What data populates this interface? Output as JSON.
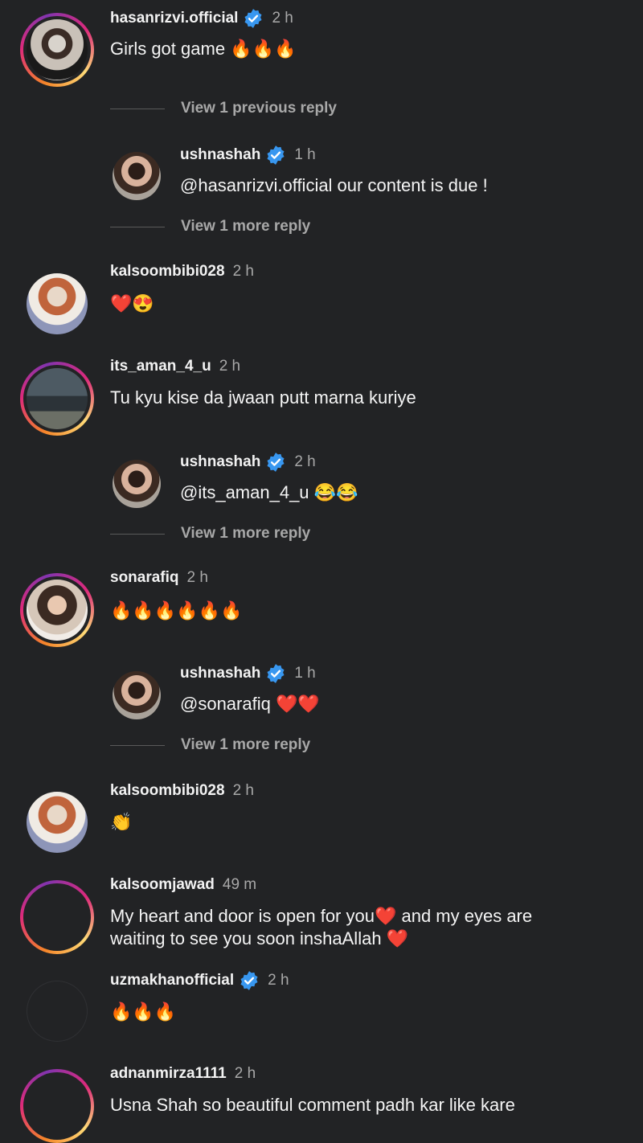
{
  "colors": {
    "background": "#222325",
    "verified_badge": "#3897f0",
    "muted_text": "#a8a8a8",
    "heart": "#e02020"
  },
  "icons": {
    "verified": "verified-badge-icon",
    "fire": "fire-emoji",
    "heart": "red-heart-emoji",
    "heart_eyes": "heart-eyes-emoji",
    "tears_of_joy": "face-with-tears-of-joy-emoji",
    "clap": "clapping-hands-emoji"
  },
  "comments": [
    {
      "username": "hasanrizvi.official",
      "verified": true,
      "time": "2 h",
      "text": "Girls got game 🔥🔥🔥"
    },
    {
      "view_replies": "View 1 previous reply"
    },
    {
      "username": "ushnashah",
      "verified": true,
      "time": "1 h",
      "text": "@hasanrizvi.official our content is due !"
    },
    {
      "view_replies": "View 1 more reply"
    },
    {
      "username": "kalsoombibi028",
      "verified": false,
      "time": "2 h",
      "text": "❤️😍"
    },
    {
      "username": "its_aman_4_u",
      "verified": false,
      "time": "2 h",
      "text": "Tu kyu kise da jwaan putt marna kuriye"
    },
    {
      "username": "ushnashah",
      "verified": true,
      "time": "2 h",
      "text": "@its_aman_4_u 😂😂"
    },
    {
      "view_replies": "View 1 more reply"
    },
    {
      "username": "sonarafiq",
      "verified": false,
      "time": "2 h",
      "text": "🔥🔥🔥🔥🔥🔥"
    },
    {
      "username": "ushnashah",
      "verified": true,
      "time": "1 h",
      "text": "@sonarafiq ❤️❤️"
    },
    {
      "view_replies": "View 1 more reply"
    },
    {
      "username": "kalsoombibi028",
      "verified": false,
      "time": "2 h",
      "text": "👏"
    },
    {
      "username": "kalsoomjawad",
      "verified": false,
      "time": "49 m",
      "text_line1": "My heart and door is open for you❤️ and my eyes are",
      "text_line2": "waiting to see you soon inshaAllah ❤️"
    },
    {
      "username": "uzmakhanofficial",
      "verified": true,
      "time": "2 h",
      "text": "🔥🔥🔥"
    },
    {
      "username": "adnanmirza1111",
      "verified": false,
      "time": "2 h",
      "text": "Usna Shah so beautiful comment padh kar like kare"
    }
  ]
}
